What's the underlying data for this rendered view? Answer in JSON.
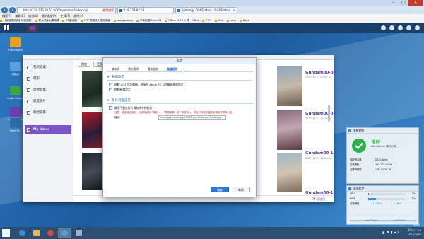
{
  "browser": {
    "url": "http://118.233.82.53:5000/webman/index.cgi",
    "cert_warning": "憑證錯誤",
    "tabs": [
      {
        "label": "118.233.82.53"
      },
      {
        "label": "Synology DiskStation - DiskStation"
      }
    ],
    "menu": [
      "檔案(F)",
      "編輯(E)",
      "檢視(V)",
      "我的最愛(A)",
      "工具(T)",
      "說明(H)"
    ],
    "favorites": [
      "【老貓測試網】科技新知",
      "舊台灣最大購物網",
      "BT動漫網",
      "LTTC財團法人語言訓練",
      "morganteng",
      "中華民國MakerFM",
      "Office 2013 入門 - Office",
      "CAD",
      "Mail",
      "web",
      "Bank"
    ]
  },
  "desktop": {
    "icons": [
      {
        "label": "File Station"
      },
      {
        "label": "控制台"
      },
      {
        "label": "Audio Station"
      },
      {
        "label": "Video Station"
      },
      {
        "label": "Word Pr..."
      }
    ]
  },
  "video_station": {
    "sidebar": [
      {
        "label": "我的收藏",
        "active": false
      },
      {
        "label": "電影",
        "active": false
      },
      {
        "label": "電視影集",
        "active": false
      },
      {
        "label": "家庭影片",
        "active": false
      },
      {
        "label": "電視錄影",
        "active": false
      },
      {
        "label": "My Video",
        "active": true
      }
    ],
    "toolbar": [
      "播放",
      "更多"
    ],
    "videos": [
      {
        "title": "Gundam00-08",
        "date": "2007-11-11 02:25:32"
      },
      {
        "title": "Gundam00-09",
        "date": "2007-12-01 22:26:18"
      },
      {
        "title": "Gundam00-12",
        "date": "2007-12-22 22:26:34"
      },
      {
        "title": "Gundam00-15",
        "date": ""
      }
    ],
    "item_count": "74 個項目"
  },
  "settings_dialog": {
    "title": "設定",
    "tabs": [
      "基本資",
      "數位電視",
      "播放設定",
      "進階設定"
    ],
    "active_tab": 3,
    "section1": {
      "header": "轉檔設定",
      "options": [
        "啟動 AC3 音訊編碼，直接在 Apple TV 以此編碼播放影片",
        "啟動轉檔設定"
      ]
    },
    "section2": {
      "header": "影片封面設定",
      "option": "顯示下載在影片資料夾中的封面",
      "note": "注意：若啟用此設定，系統將使用「電影」、「電視影集」或「家庭影片」等自訂封面的檔案名稱取代預設封面。",
      "field_label": "檔名:",
      "field_value": "cover.jpg,Cover.jpg,COVER.jpg,folder.jpg,Folder.jpg"
    },
    "ok": "確定",
    "cancel": "取消"
  },
  "system_widget": {
    "title": "系統狀態",
    "status": "良好",
    "status_desc": "DiskStation 運作正常。",
    "rows": [
      {
        "label": "伺服器名稱",
        "value": "DS214play"
      },
      {
        "label": "區域網路",
        "value": "118.233.82.53"
      },
      {
        "label": "已運轉時間",
        "value": "1 天 00:26:16"
      }
    ]
  },
  "resource_widget": {
    "title": "資源監控",
    "cpu_label": "CPU",
    "cpu_value": "2%",
    "cpu_fraction": 0.02,
    "ram_label": "RAM",
    "ram_value": "22%",
    "ram_fraction": 0.22,
    "net_label": "區域網路",
    "net_up": "1 KB/s",
    "net_down": "3 KB/s"
  },
  "taskbar": {
    "time": "下午 11:04",
    "date": "2014/4/30",
    "zoom": "100%"
  },
  "colors": {
    "accent_purple": "#7b55c8",
    "link_blue": "#1a64b8",
    "ok_green": "#2db14b"
  }
}
